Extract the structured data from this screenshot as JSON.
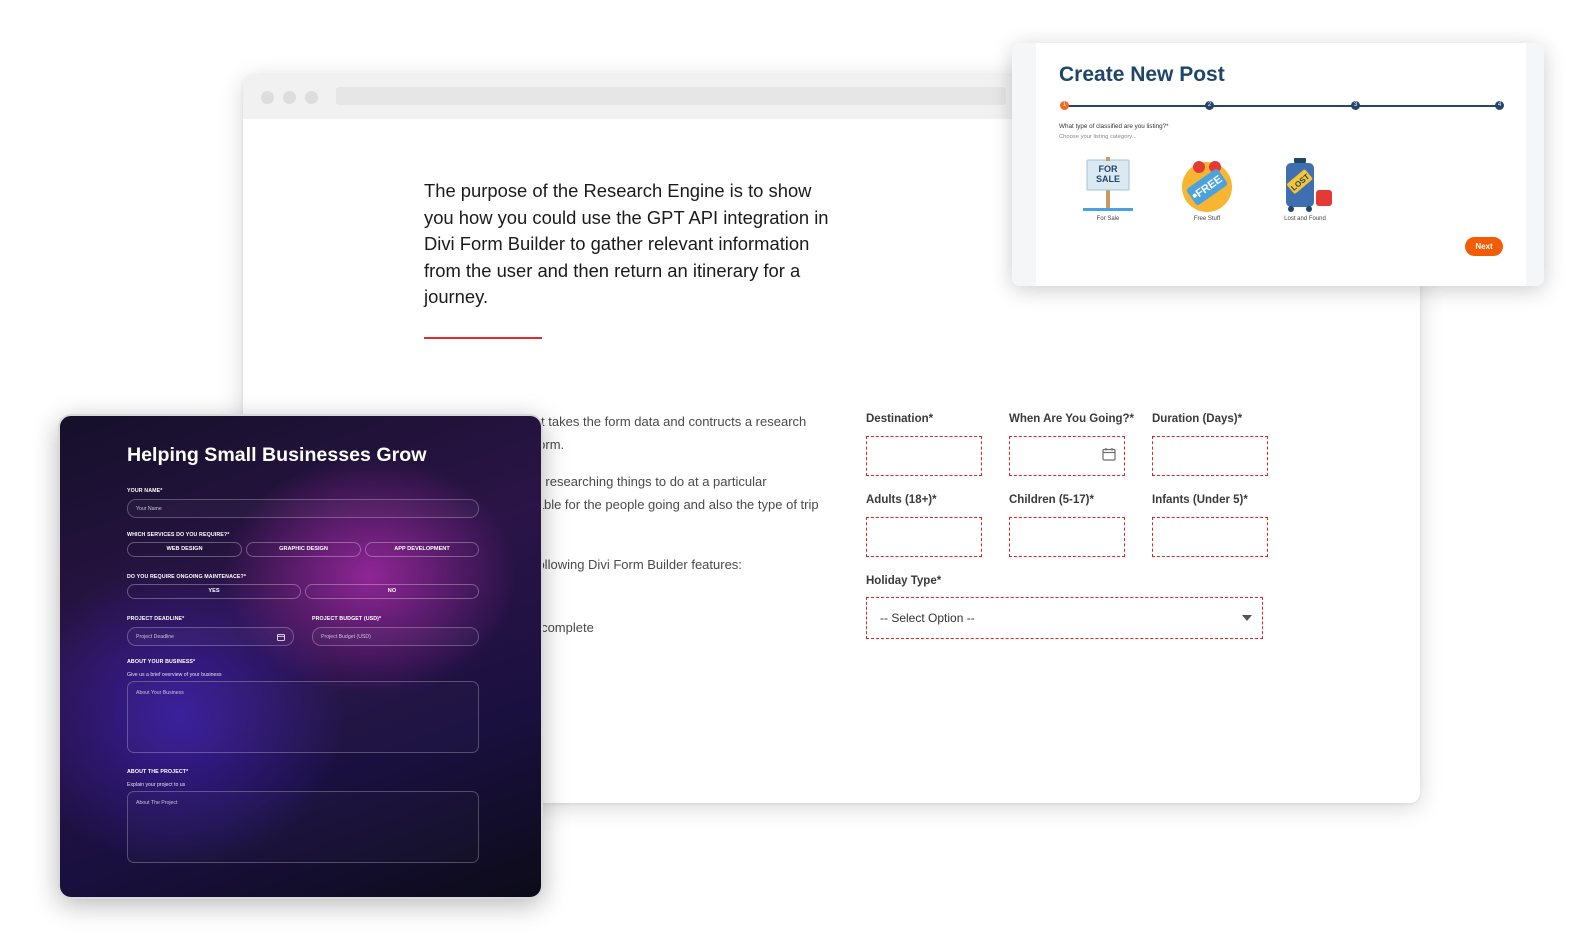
{
  "research": {
    "intro": "The purpose of the Research Engine is to show you how you could use the GPT API integration in Divi Form Builder to gather relevant information from the user and then return an itinerary for a journey.",
    "body_lines": [
      "mpt takes the form data and contructs a research",
      "erform.",
      "are researching things to do at a particular",
      "uitable for the people going and also the type of trip",
      "e.",
      "e following Divi Form Builder features:",
      "utocomplete"
    ],
    "fields": {
      "destination": "Destination*",
      "when": "When Are You Going?*",
      "duration": "Duration (Days)*",
      "adults": "Adults (18+)*",
      "children": "Children (5-17)*",
      "infants": "Infants (Under 5)*",
      "holiday_type": "Holiday Type*",
      "select_placeholder": "-- Select Option --"
    }
  },
  "post": {
    "title": "Create New Post",
    "steps": [
      "1",
      "2",
      "3",
      "4"
    ],
    "active_step": 1,
    "question": "What type of classified are you listing?*",
    "subtext": "Choose your listing category...",
    "categories": [
      {
        "label": "For Sale",
        "badge": "FOR SALE",
        "icon": "for-sale-sign-icon"
      },
      {
        "label": "Free Stuff",
        "badge": "FREE",
        "icon": "free-tag-icon"
      },
      {
        "label": "Lost and Found",
        "badge": "LOST",
        "icon": "lost-luggage-icon"
      }
    ],
    "next_label": "Next",
    "accent_color": "#f25c05",
    "primary_color": "#1f4669"
  },
  "business": {
    "title": "Helping Small Businesses Grow",
    "name_label": "YOUR NAME*",
    "name_placeholder": "Your Name",
    "services_label": "WHICH SERVICES DO YOU REQUIRE?*",
    "services": [
      "WEB DESIGN",
      "GRAPHIC DESIGN",
      "APP DEVELOPMENT"
    ],
    "maintenance_label": "DO YOU REQUIRE ONGOING MAINTENACE?*",
    "maintenance_options": [
      "YES",
      "NO"
    ],
    "deadline_label": "PROJECT DEADLINE*",
    "deadline_placeholder": "Project Deadline",
    "budget_label": "PROJECT BUDGET (USD)*",
    "budget_placeholder": "Project Budget (USD)",
    "about_business_label": "ABOUT YOUR BUSINESS*",
    "about_business_hint": "Give us a brief overview of your business",
    "about_business_placeholder": "About Your Business",
    "about_project_label": "ABOUT THE PROJECT*",
    "about_project_hint": "Explain your project to us",
    "about_project_placeholder": "About The Project"
  }
}
